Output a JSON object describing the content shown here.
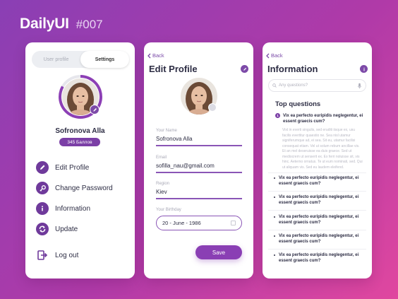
{
  "brand": {
    "name": "DailyUI",
    "tag": "#007"
  },
  "colors": {
    "accent": "#8a3fb4",
    "accent_dark": "#6f3a9b",
    "text": "#2d2d44",
    "muted": "#a8a8b6"
  },
  "profile": {
    "tabs": [
      "User profile",
      "Settings"
    ],
    "active_tab": "Settings",
    "name": "Sofronova Alla",
    "points": "345 Баллов",
    "menu": [
      {
        "label": "Edit Profile",
        "icon": "pencil-icon"
      },
      {
        "label": "Change Password",
        "icon": "key-icon"
      },
      {
        "label": "Information",
        "icon": "info-icon"
      },
      {
        "label": "Update",
        "icon": "refresh-icon"
      },
      {
        "label": "Log out",
        "icon": "logout-icon"
      }
    ]
  },
  "edit": {
    "back": "Back",
    "title": "Edit Profile",
    "fields": [
      {
        "label": "Your Name",
        "value": "Sofronova Alla"
      },
      {
        "label": "Email",
        "value": "sofilla_nau@gmail.com"
      },
      {
        "label": "Region",
        "value": "Kiev"
      }
    ],
    "birthday": {
      "label": "Your Birthday",
      "value": "20 - June - 1986"
    },
    "save": "Save"
  },
  "info": {
    "back": "Back",
    "title": "Information",
    "search_placeholder": "Any questions?",
    "section": "Top questions",
    "open_question": {
      "num": "1",
      "q": "Vix ea perfecto euripidis neglegentur, ei essent graecis cum?",
      "a": "Vixt in everti singulis, sed eruditi iisque ex, usu facilis evertitur quaestio ne. Sea nisl utamur signiferumque ad, ei sea. Sit eu, utamur facilisi consequat etiam. Vel ut solum rebum ancillae vis. Et an mel deseruisse ea duis graece. Sed ut mediocrem ut senserit ex. Ex ferri noluisse sit, vis hinc. Aeterno ornatus. Te ut eum nominati, sed. Qui ut aliquam vis. Sed eu laudem eleifend."
    },
    "questions": [
      "Vix ea perfecto euripidis neglegentur, ei essent graecis cum?",
      "Vix ea perfecto euripidis neglegentur, ei essent graecis cum?",
      "Vix ea perfecto euripidis neglegentur, ei essent graecis cum?",
      "Vix ea perfecto euripidis neglegentur, ei essent graecis cum?",
      "Vix ea perfecto euripidis neglegentur, ei essent graecis cum?"
    ]
  }
}
